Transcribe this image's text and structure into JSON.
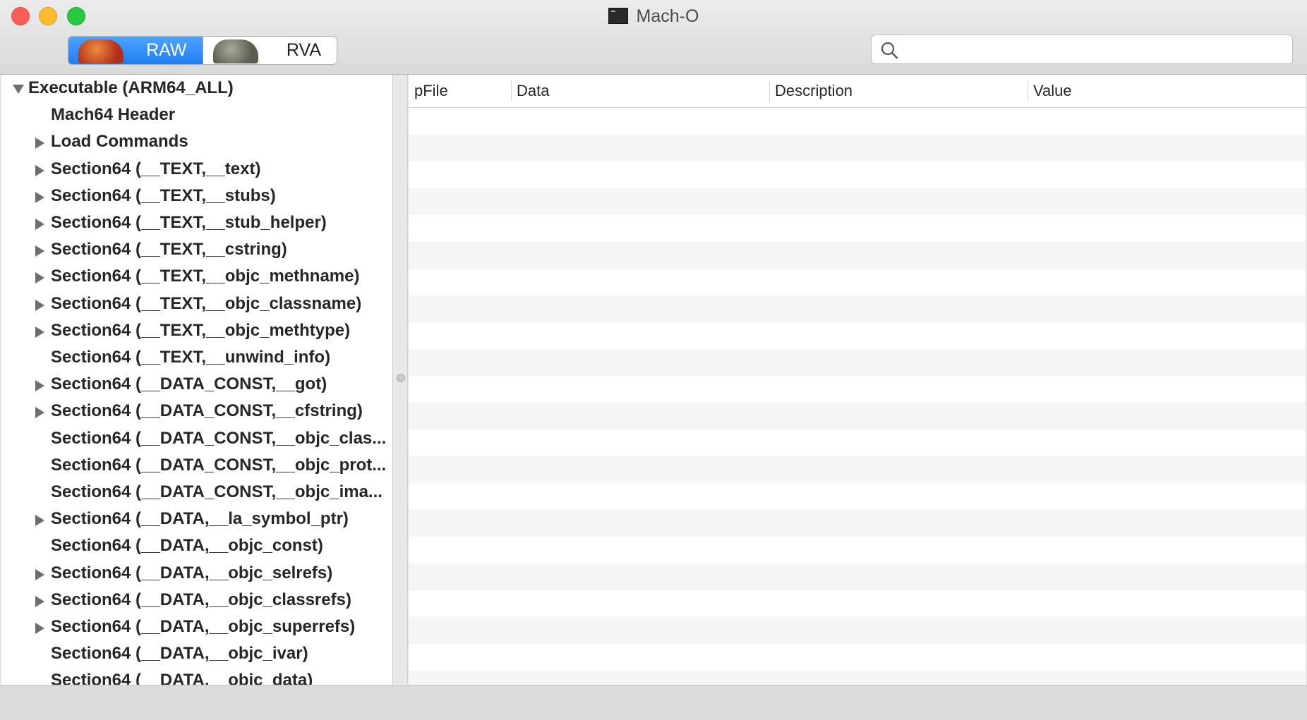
{
  "window": {
    "title": "Mach-O"
  },
  "toolbar": {
    "segments": [
      {
        "label": "RAW",
        "selected": true
      },
      {
        "label": "RVA",
        "selected": false
      }
    ],
    "search": {
      "value": "",
      "placeholder": ""
    }
  },
  "tree": {
    "items": [
      {
        "label": "Executable  (ARM64_ALL)",
        "level": 0,
        "disclosure": "expanded"
      },
      {
        "label": "Mach64 Header",
        "level": 1,
        "disclosure": "none"
      },
      {
        "label": "Load Commands",
        "level": 1,
        "disclosure": "collapsed"
      },
      {
        "label": "Section64 (__TEXT,__text)",
        "level": 1,
        "disclosure": "collapsed"
      },
      {
        "label": "Section64 (__TEXT,__stubs)",
        "level": 1,
        "disclosure": "collapsed"
      },
      {
        "label": "Section64 (__TEXT,__stub_helper)",
        "level": 1,
        "disclosure": "collapsed"
      },
      {
        "label": "Section64 (__TEXT,__cstring)",
        "level": 1,
        "disclosure": "collapsed"
      },
      {
        "label": "Section64 (__TEXT,__objc_methname)",
        "level": 1,
        "disclosure": "collapsed"
      },
      {
        "label": "Section64 (__TEXT,__objc_classname)",
        "level": 1,
        "disclosure": "collapsed"
      },
      {
        "label": "Section64 (__TEXT,__objc_methtype)",
        "level": 1,
        "disclosure": "collapsed"
      },
      {
        "label": "Section64 (__TEXT,__unwind_info)",
        "level": 1,
        "disclosure": "none"
      },
      {
        "label": "Section64 (__DATA_CONST,__got)",
        "level": 1,
        "disclosure": "collapsed"
      },
      {
        "label": "Section64 (__DATA_CONST,__cfstring)",
        "level": 1,
        "disclosure": "collapsed"
      },
      {
        "label": "Section64 (__DATA_CONST,__objc_clas...",
        "level": 1,
        "disclosure": "none"
      },
      {
        "label": "Section64 (__DATA_CONST,__objc_prot...",
        "level": 1,
        "disclosure": "none"
      },
      {
        "label": "Section64 (__DATA_CONST,__objc_ima...",
        "level": 1,
        "disclosure": "none"
      },
      {
        "label": "Section64 (__DATA,__la_symbol_ptr)",
        "level": 1,
        "disclosure": "collapsed"
      },
      {
        "label": "Section64 (__DATA,__objc_const)",
        "level": 1,
        "disclosure": "none"
      },
      {
        "label": "Section64 (__DATA,__objc_selrefs)",
        "level": 1,
        "disclosure": "collapsed"
      },
      {
        "label": "Section64 (__DATA,__objc_classrefs)",
        "level": 1,
        "disclosure": "collapsed"
      },
      {
        "label": "Section64 (__DATA,__objc_superrefs)",
        "level": 1,
        "disclosure": "collapsed"
      },
      {
        "label": "Section64 (__DATA,__objc_ivar)",
        "level": 1,
        "disclosure": "none"
      },
      {
        "label": "Section64 (__DATA,__objc_data)",
        "level": 1,
        "disclosure": "none"
      }
    ]
  },
  "table": {
    "columns": [
      "pFile",
      "Data",
      "Description",
      "Value"
    ],
    "rows": []
  },
  "colors": {
    "selected_segment": "#1f7ef0",
    "stripe": "#f4f5f5",
    "disclosure": "#6e6e6e"
  }
}
